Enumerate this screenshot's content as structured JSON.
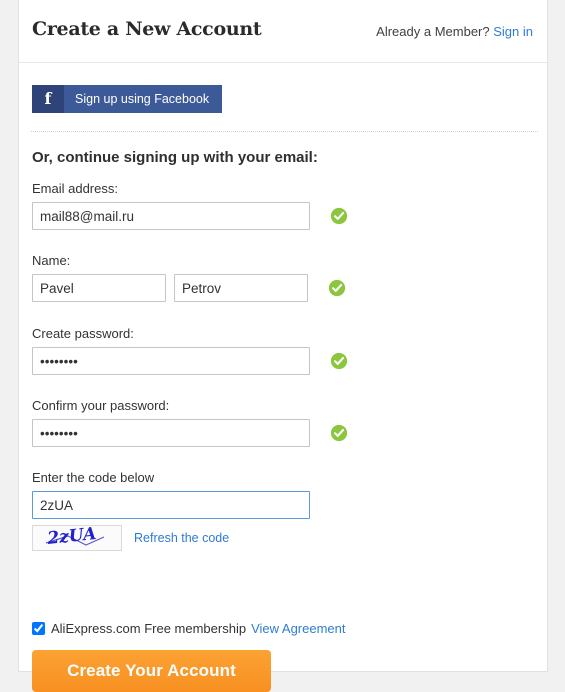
{
  "header": {
    "title": "Create a New Account",
    "member_prompt": "Already a Member?",
    "signin_label": "Sign in"
  },
  "social": {
    "facebook_icon": "facebook-f-icon",
    "facebook_glyph": "f",
    "facebook_label": "Sign up using Facebook"
  },
  "section": {
    "heading": "Or, continue signing up with your email:"
  },
  "fields": {
    "email": {
      "label": "Email address:",
      "value": "mail88@mail.ru",
      "placeholder": "",
      "valid_icon": "check-circle-icon"
    },
    "name": {
      "label": "Name:",
      "first_value": "Pavel",
      "first_placeholder": "",
      "last_value": "Petrov",
      "last_placeholder": "",
      "valid_icon": "check-circle-icon"
    },
    "password": {
      "label": "Create password:",
      "value": "••••••••",
      "placeholder": "",
      "valid_icon": "check-circle-icon"
    },
    "confirm_password": {
      "label": "Confirm your password:",
      "value": "••••••••",
      "placeholder": "",
      "valid_icon": "check-circle-icon"
    },
    "captcha": {
      "label": "Enter the code below",
      "value": "2zUA",
      "placeholder": "",
      "image_text": "2zUA",
      "refresh_label": "Refresh the code"
    }
  },
  "agreement": {
    "checked": true,
    "text": "AliExpress.com Free membership",
    "link_label": "View Agreement"
  },
  "submit": {
    "label": "Create Your Account"
  },
  "colors": {
    "facebook_blue": "#3d5a98",
    "facebook_dark": "#2e4479",
    "link_blue": "#2e7cd6",
    "valid_green": "#8cc63f",
    "submit_orange": "#f89022",
    "focus_blue": "#5b9bd5",
    "captcha_ink": "#2222cc"
  }
}
